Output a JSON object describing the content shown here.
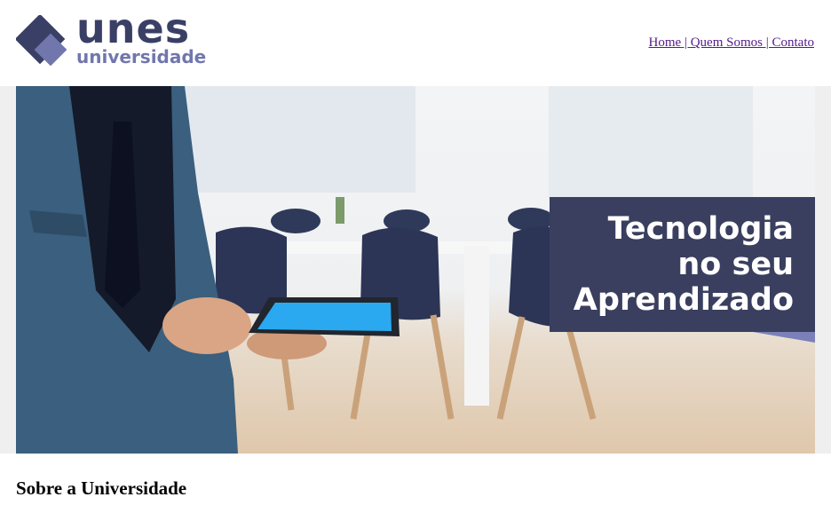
{
  "header": {
    "logo": {
      "icon": "diamond-logo-icon",
      "word": "unes",
      "subword": "universidade",
      "colors": {
        "primary": "#3a3f66",
        "secondary": "#7177ad"
      }
    },
    "nav": {
      "links": [
        {
          "label": "Home"
        },
        {
          "label": "Quem Somos"
        },
        {
          "label": "Contato"
        }
      ],
      "separator": " | ",
      "link_color": "#551a8b"
    }
  },
  "banner": {
    "caption": {
      "line1": "Tecnologia",
      "line2": "no seu",
      "line3": "Aprendizado"
    },
    "caption_color": "#3a3f5f",
    "accent_color": "#7c80b8"
  },
  "main": {
    "section_title": "Sobre a Universidade"
  }
}
